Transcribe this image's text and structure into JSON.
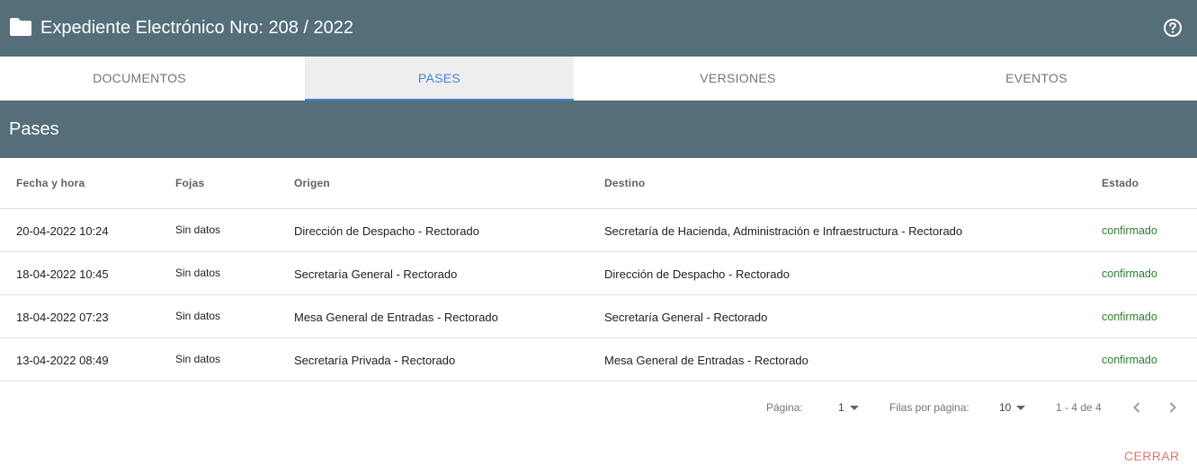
{
  "header": {
    "title": "Expediente Electrónico Nro: 208 / 2022",
    "folder_icon": "folder-icon",
    "help_icon": "help-circle-icon"
  },
  "tabs": [
    {
      "label": "DOCUMENTOS",
      "active": false
    },
    {
      "label": "PASES",
      "active": true
    },
    {
      "label": "VERSIONES",
      "active": false
    },
    {
      "label": "EVENTOS",
      "active": false
    }
  ],
  "section": {
    "title": "Pases"
  },
  "table": {
    "headers": [
      "Fecha y hora",
      "Fojas",
      "Origen",
      "Destino",
      "Estado"
    ],
    "rows": [
      [
        "20-04-2022 10:24",
        "Sin datos",
        "Dirección de Despacho - Rectorado",
        "Secretaría de Hacienda, Administración e Infraestructura - Rectorado",
        "confirmado"
      ],
      [
        "18-04-2022 10:45",
        "Sin datos",
        "Secretaría General - Rectorado",
        "Dirección de Despacho - Rectorado",
        "confirmado"
      ],
      [
        "18-04-2022 07:23",
        "Sin datos",
        "Mesa General de Entradas - Rectorado",
        "Secretaría General - Rectorado",
        "confirmado"
      ],
      [
        "13-04-2022 08:49",
        "Sin datos",
        "Secretaría Privada - Rectorado",
        "Mesa General de Entradas - Rectorado",
        "confirmado"
      ]
    ]
  },
  "pagination": {
    "page_label": "Página:",
    "page_value": "1",
    "rows_label": "Filas por página:",
    "rows_value": "10",
    "range": "1 - 4 de 4"
  },
  "footer": {
    "close_label": "CERRAR"
  },
  "colors": {
    "header_bg": "#546e7a",
    "accent": "#3f88d8",
    "status_ok": "#2e7d32",
    "close": "#e57373"
  }
}
